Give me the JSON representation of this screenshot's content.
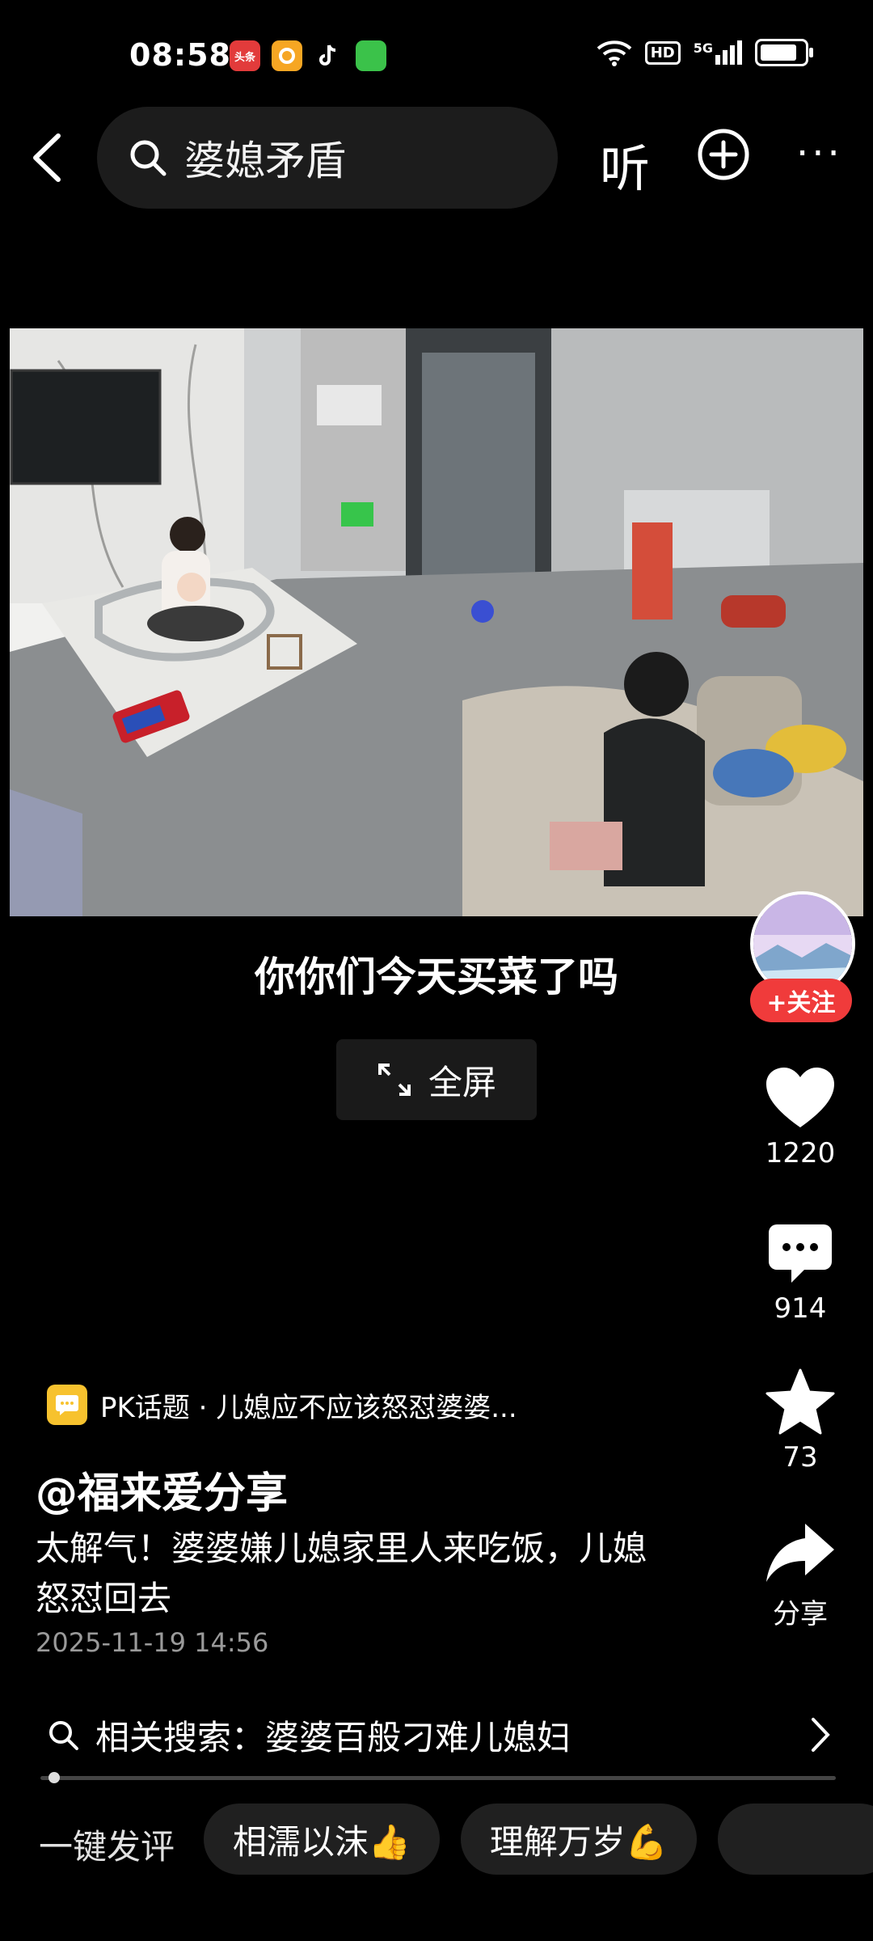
{
  "status_bar": {
    "time": "08:58",
    "apps": [
      {
        "name": "头条",
        "color": "#e23b3b"
      },
      {
        "name": "",
        "color": "#f6a623"
      },
      {
        "name": "",
        "color": "#111111"
      },
      {
        "name": "",
        "color": "#3bc24a"
      }
    ],
    "network": "5G",
    "hd_label": "HD",
    "battery_level": 0.85
  },
  "nav": {
    "search_text": "婆媳矛盾",
    "listen_label": "听"
  },
  "video": {
    "subtitle": "你你们今天买菜了吗",
    "fullscreen_label": "全屏",
    "progress": 0.01
  },
  "rail": {
    "follow_label": "+关注",
    "likes": "1220",
    "comments": "914",
    "favorites": "73",
    "share_label": "分享"
  },
  "caption": {
    "topic": "PK话题 · 儿媳应不应该怒怼婆婆...",
    "author": "@福来爱分享",
    "description": "太解气！婆婆嫌儿媳家里人来吃饭，儿媳怒怼回去",
    "date": "2025-11-19 14:56"
  },
  "related": {
    "text": "相关搜索：婆婆百般刁难儿媳妇"
  },
  "quick_comment": {
    "label": "一键发评",
    "chips": [
      "相濡以沫👍",
      "理解万岁💪",
      ""
    ]
  }
}
